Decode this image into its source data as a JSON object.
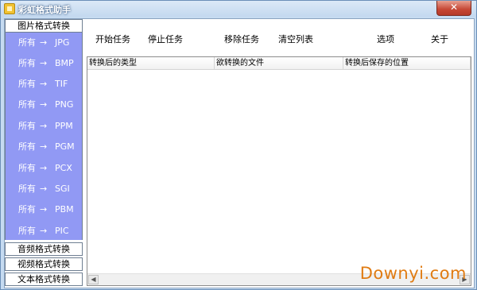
{
  "window": {
    "title": "彩虹格式助手",
    "close_label": "✕"
  },
  "nav": {
    "categories": [
      "图片格式转换",
      "音频格式转换",
      "视频格式转换",
      "文本格式转换"
    ],
    "formats": [
      {
        "from": "所有",
        "arrow": "→",
        "to": "JPG"
      },
      {
        "from": "所有",
        "arrow": "→",
        "to": "BMP"
      },
      {
        "from": "所有",
        "arrow": "→",
        "to": "TIF"
      },
      {
        "from": "所有",
        "arrow": "→",
        "to": "PNG"
      },
      {
        "from": "所有",
        "arrow": "→",
        "to": "PPM"
      },
      {
        "from": "所有",
        "arrow": "→",
        "to": "PGM"
      },
      {
        "from": "所有",
        "arrow": "→",
        "to": "PCX"
      },
      {
        "from": "所有",
        "arrow": "→",
        "to": "SGI"
      },
      {
        "from": "所有",
        "arrow": "→",
        "to": "PBM"
      },
      {
        "from": "所有",
        "arrow": "→",
        "to": "PIC"
      }
    ]
  },
  "toolbar": {
    "start": "开始任务",
    "stop": "停止任务",
    "remove": "移除任务",
    "clear": "清空列表",
    "options": "选项",
    "about": "关于"
  },
  "list": {
    "columns": [
      "转换后的类型",
      "欲转换的文件",
      "转换后保存的位置"
    ],
    "rows": []
  },
  "watermark": "Downyi.com"
}
